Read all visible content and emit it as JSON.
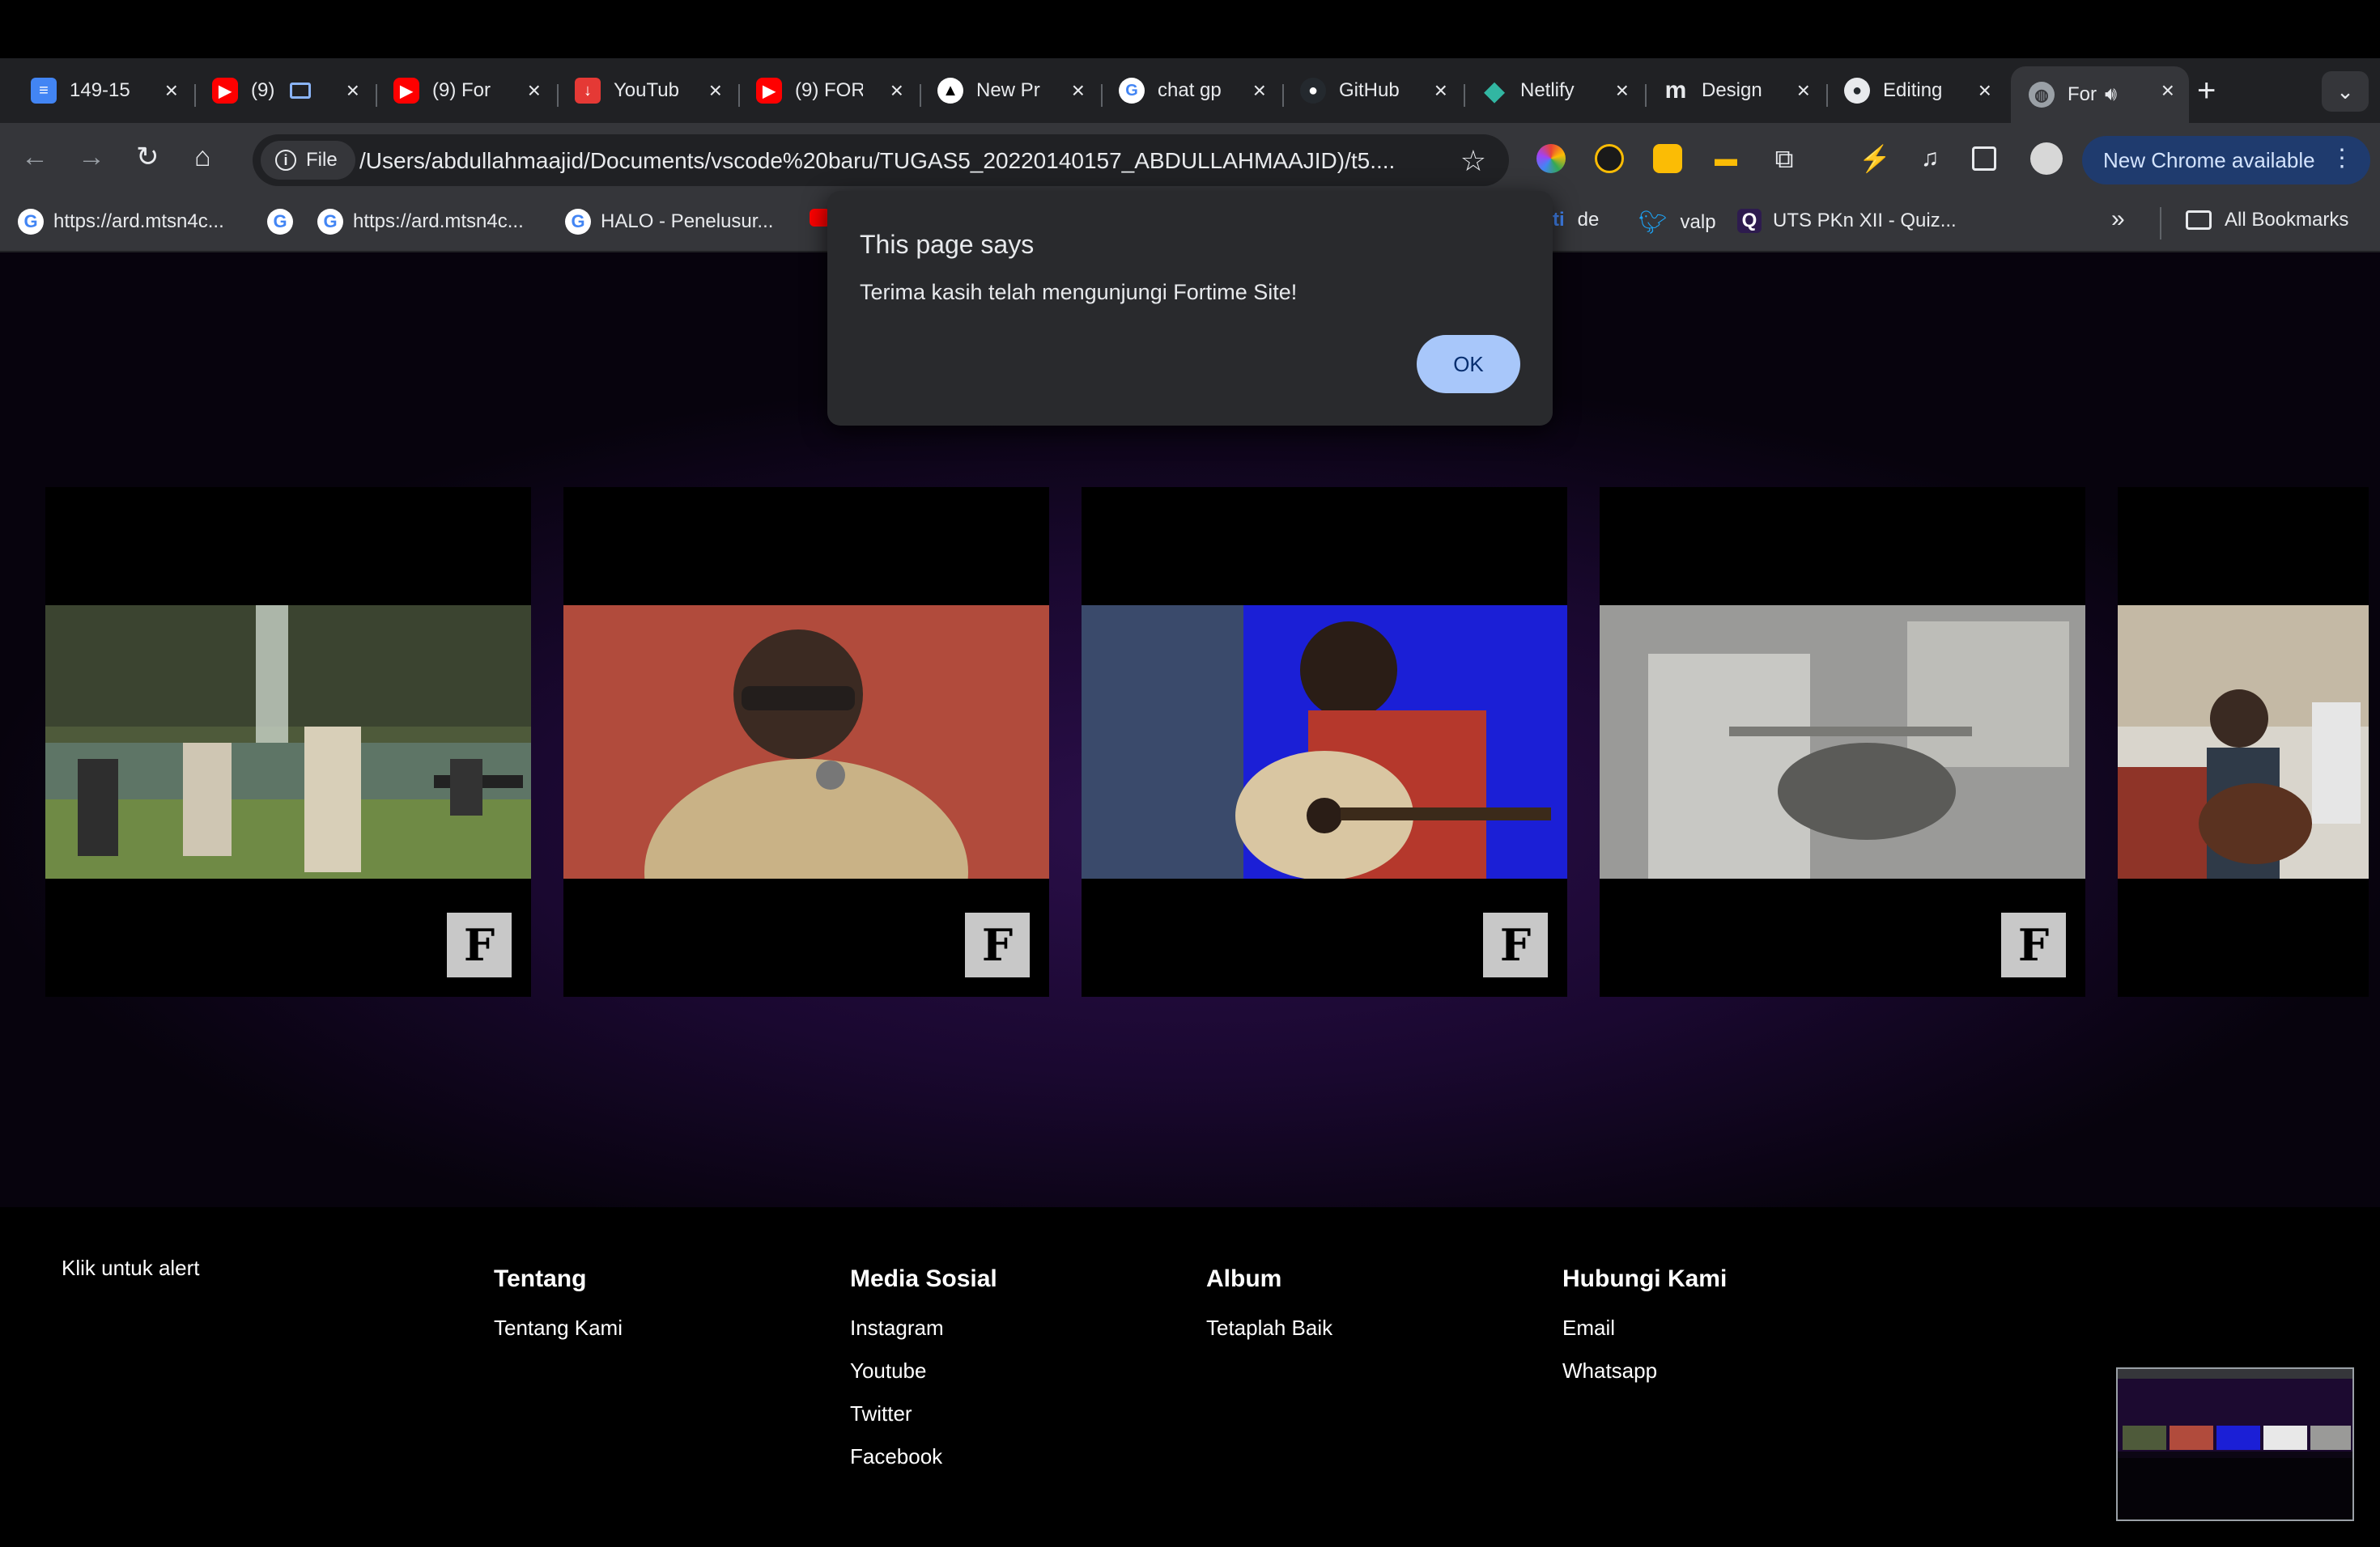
{
  "browser": {
    "tabs": [
      {
        "title": "149-15",
        "icon": "docs-icon",
        "color": "#4285f4"
      },
      {
        "title": "(9)",
        "icon": "youtube-icon",
        "color": "#ff0000"
      },
      {
        "title": "(9) For",
        "icon": "youtube-icon",
        "color": "#ff0000"
      },
      {
        "title": "YouTub",
        "icon": "download-icon",
        "color": "#e53935"
      },
      {
        "title": "(9) FOR",
        "icon": "youtube-icon",
        "color": "#ff0000"
      },
      {
        "title": "New Pr",
        "icon": "triangle-icon",
        "color": "#000000"
      },
      {
        "title": "chat gp",
        "icon": "google-icon",
        "color": "#ffffff"
      },
      {
        "title": "GitHub",
        "icon": "github-icon",
        "color": "#24292e"
      },
      {
        "title": "Netlify",
        "icon": "netlify-icon",
        "color": "#32b6a2"
      },
      {
        "title": "Design",
        "icon": "design-icon",
        "color": "#202124"
      },
      {
        "title": "Editing",
        "icon": "github-icon",
        "color": "#24292e"
      },
      {
        "title": "For",
        "icon": "globe-icon",
        "color": "#9aa0a6"
      }
    ],
    "new_tab": "+",
    "address": {
      "chip_label": "File",
      "url": "/Users/abdullahmaajid/Documents/vscode%20baru/TUGAS5_20220140157_ABDULLAHMAAJID)/t5...."
    },
    "update_label": "New Chrome available",
    "bookmarks": [
      {
        "label": "https://ard.mtsn4c...",
        "icon": "google-icon"
      },
      {
        "label": "",
        "icon": "google-icon"
      },
      {
        "label": "https://ard.mtsn4c...",
        "icon": "google-icon"
      },
      {
        "label": "HALO - Penelusur...",
        "icon": "google-icon"
      },
      {
        "label": "de",
        "icon": "ti-icon"
      },
      {
        "label": "valp",
        "icon": "twitter-icon"
      },
      {
        "label": "UTS PKn XII - Quiz...",
        "icon": "quizizz-icon"
      }
    ],
    "more_bookmarks": "»",
    "all_bookmarks": "All Bookmarks"
  },
  "dialog": {
    "title": "This page says",
    "message": "Terima kasih telah mengunjungi Fortime Site!",
    "ok_label": "OK"
  },
  "videos": [
    {
      "name": "video-1",
      "logo": "F"
    },
    {
      "name": "video-2",
      "logo": "F"
    },
    {
      "name": "video-3",
      "logo": "F"
    },
    {
      "name": "video-4",
      "logo": "F"
    },
    {
      "name": "video-5",
      "logo": ""
    }
  ],
  "footer": {
    "columns": [
      {
        "title": "Tentang",
        "links": [
          "Tentang Kami"
        ]
      },
      {
        "title": "Media Sosial",
        "links": [
          "Instagram",
          "Youtube",
          "Twitter",
          "Facebook"
        ]
      },
      {
        "title": "Album",
        "links": [
          "Tetaplah Baik"
        ]
      },
      {
        "title": "Hubungi Kami",
        "links": [
          "Email",
          "Whatsapp"
        ]
      }
    ],
    "alert_link": "Klik untuk alert"
  }
}
